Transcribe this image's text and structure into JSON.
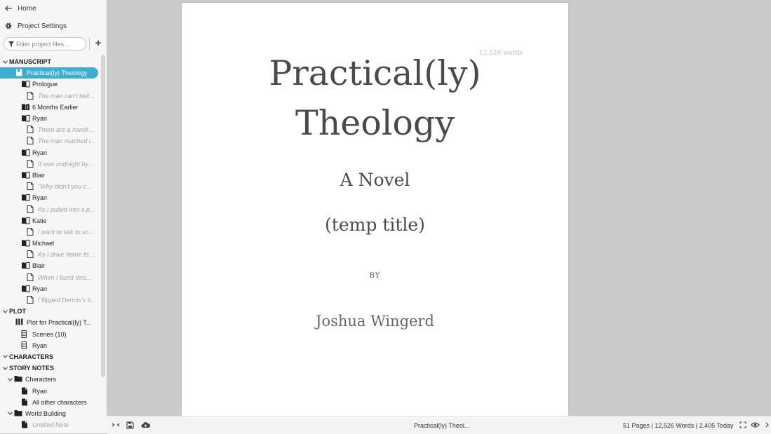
{
  "sidebar": {
    "home": "Home",
    "project_settings": "Project Settings",
    "filter_placeholder": "Filter project files...",
    "add_label": "+"
  },
  "tree": [
    {
      "type": "section",
      "label": "MANUSCRIPT",
      "depth": 0,
      "expanded": true
    },
    {
      "type": "book",
      "label": "Practical(ly) Theology",
      "depth": 1,
      "selected": true
    },
    {
      "type": "chapter",
      "label": "Prologue",
      "depth": 2
    },
    {
      "type": "scene",
      "label": "The man can't beli...",
      "depth": 3
    },
    {
      "type": "chapter-multi",
      "label": "6 Months Earlier",
      "depth": 2
    },
    {
      "type": "chapter",
      "label": "Ryan",
      "depth": 2
    },
    {
      "type": "scene",
      "label": "There are a handf...",
      "depth": 3
    },
    {
      "type": "scene",
      "label": "The man reached i...",
      "depth": 3
    },
    {
      "type": "chapter",
      "label": "Ryan",
      "depth": 2
    },
    {
      "type": "scene",
      "label": "It was midnight by...",
      "depth": 3
    },
    {
      "type": "chapter",
      "label": "Blair",
      "depth": 2
    },
    {
      "type": "scene",
      "label": "\"Why didn't you c...",
      "depth": 3
    },
    {
      "type": "chapter",
      "label": "Ryan",
      "depth": 2
    },
    {
      "type": "scene",
      "label": "As I pulled into a p...",
      "depth": 3
    },
    {
      "type": "chapter",
      "label": "Katie",
      "depth": 2
    },
    {
      "type": "scene",
      "label": "I want to talk to so...",
      "depth": 3
    },
    {
      "type": "chapter",
      "label": "Michael",
      "depth": 2
    },
    {
      "type": "scene",
      "label": "As I drive home fo...",
      "depth": 3
    },
    {
      "type": "chapter",
      "label": "Blair",
      "depth": 2
    },
    {
      "type": "scene",
      "label": "When I burst thro...",
      "depth": 3
    },
    {
      "type": "chapter",
      "label": "Ryan",
      "depth": 2
    },
    {
      "type": "scene",
      "label": "I flipped Dennis's b...",
      "depth": 3
    },
    {
      "type": "section",
      "label": "PLOT",
      "depth": 0,
      "expanded": true
    },
    {
      "type": "plotgrid",
      "label": "Plot for Practical(ly) T...",
      "depth": 1
    },
    {
      "type": "plotline",
      "label": "Scenes  (10)",
      "depth": 2
    },
    {
      "type": "plotline",
      "label": "Ryan",
      "depth": 2
    },
    {
      "type": "section",
      "label": "CHARACTERS",
      "depth": 0,
      "expanded": true
    },
    {
      "type": "section",
      "label": "STORY NOTES",
      "depth": 0,
      "expanded": true
    },
    {
      "type": "folder",
      "label": "Characters",
      "depth": 1,
      "expanded": true
    },
    {
      "type": "note",
      "label": "Ryan",
      "depth": 2
    },
    {
      "type": "note",
      "label": "All other characters",
      "depth": 2
    },
    {
      "type": "folder",
      "label": "World Building",
      "depth": 1,
      "expanded": true
    },
    {
      "type": "note-untitled",
      "label": "Untitled Note",
      "depth": 2
    }
  ],
  "page": {
    "word_count": "12,526 words",
    "title_line1": "Practical(ly)",
    "title_line2": "Theology",
    "subtitle": "A Novel",
    "temp_title": "(temp title)",
    "by": "BY",
    "author": "Joshua Wingerd"
  },
  "statusbar": {
    "doc_name": "Practical(ly) Theol...",
    "stats": "51 Pages | 12,526 Words | 2,405 Today"
  },
  "colors": {
    "accent": "#3daecf"
  }
}
